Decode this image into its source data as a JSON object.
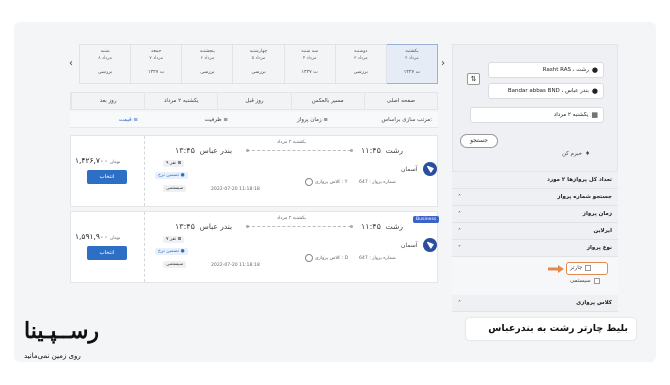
{
  "sidebar": {
    "origin": "Rasht RAS ، رشت",
    "destination": "Bandar abbas BND ، بندر عباس",
    "date": "یکشنبه ۲ مرداد",
    "search_label": "جستجو",
    "price_alert": "خبرم کن",
    "total_flights": "تعداد کل پروازها ۲ مورد",
    "filters": [
      {
        "label": "جستجو شماره پرواز"
      },
      {
        "label": "زمان پرواز"
      },
      {
        "label": "ایرلاین"
      },
      {
        "label": "نوع پرواز"
      }
    ],
    "type_options": {
      "charter": "چارتر",
      "system": "سیستمی"
    },
    "class_filter": "کلاس پروازی"
  },
  "date_strip": [
    {
      "day": "یکشنبه",
      "date": "۲ مرداد",
      "price": "۱۴۲۷ ت",
      "active": true
    },
    {
      "day": "دوشنبه",
      "date": "۳ مرداد",
      "price": "بررسی",
      "active": false
    },
    {
      "day": "سه شنبه",
      "date": "۴ مرداد",
      "price": "۱۴۲۷ ت",
      "active": false
    },
    {
      "day": "چهارشنبه",
      "date": "۵ مرداد",
      "price": "بررسی",
      "active": false
    },
    {
      "day": "پنجشنبه",
      "date": "۶ مرداد",
      "price": "بررسی",
      "active": false
    },
    {
      "day": "جمعه",
      "date": "۷ مرداد",
      "price": "۱۴۲۷ ت",
      "active": false
    },
    {
      "day": "شنبه",
      "date": "۸ مرداد",
      "price": "بررسی",
      "active": false
    }
  ],
  "nav_tabs": [
    "صفحه اصلی",
    "مسیر بالعکس",
    "روز قبل",
    "یکشنبه ۲ مرداد",
    "روز بعد"
  ],
  "sort": {
    "label": "مرتب سازی براساس:",
    "options": [
      "زمان پرواز",
      "ظرفیت",
      "قیمت"
    ]
  },
  "flights": [
    {
      "from": "رشت",
      "dep_time": "۱۱:۴۵",
      "to": "بندر عباس",
      "arr_time": "۱۳:۴۵",
      "route_date": "یکشنبه ۲ مرداد",
      "airline": "آسمان",
      "flight_no": "شماره پرواز : 647",
      "class": "کلاس پروازی : Y",
      "seats": "۹ نفر",
      "guarantee": "تضمین نرخ",
      "type": "سیستمی",
      "timestamp": "2022-07-20 11:18:18",
      "price": "۱,۴۲۶,۷۰۰",
      "currency": "تومان",
      "select_label": "انتخاب",
      "badge": ""
    },
    {
      "from": "رشت",
      "dep_time": "۱۱:۴۵",
      "to": "بندر عباس",
      "arr_time": "۱۳:۴۵",
      "route_date": "یکشنبه ۲ مرداد",
      "airline": "آسمان",
      "flight_no": "شماره پرواز : 647",
      "class": "کلاس پروازی : D",
      "seats": "۷ نفر",
      "guarantee": "تضمین نرخ",
      "type": "سیستمی",
      "timestamp": "2022-07-20 11:18:18",
      "price": "۱,۵۹۱,۹۰۰",
      "currency": "تومان",
      "select_label": "انتخاب",
      "badge": "Business"
    }
  ],
  "caption": "بلیط چارتر رشت به بندرعباس",
  "brand": {
    "name": "رســپـینا",
    "tagline": "روی زمین نمی‌مانید"
  },
  "colors": {
    "primary": "#2c6fc4",
    "accent": "#e3894f",
    "business_badge": "#3d63c9"
  }
}
